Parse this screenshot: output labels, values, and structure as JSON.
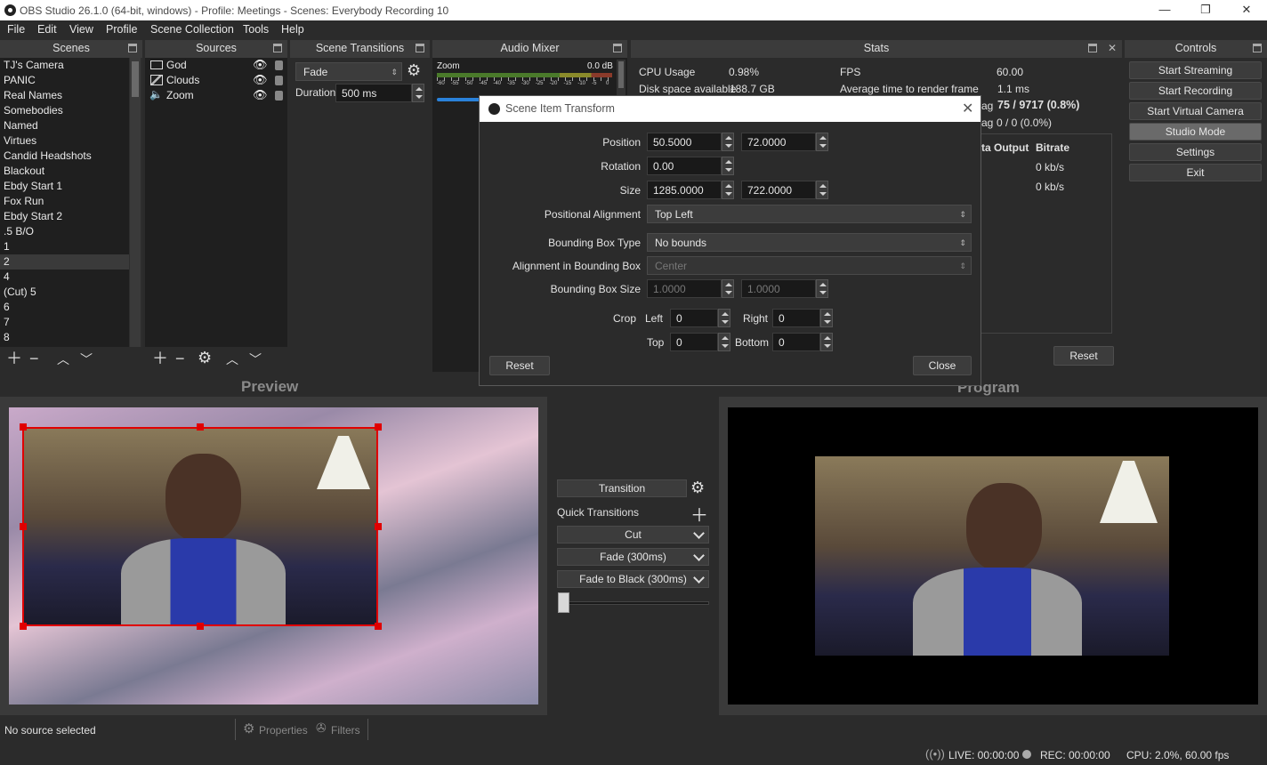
{
  "window": {
    "title": "OBS Studio 26.1.0 (64-bit, windows) - Profile: Meetings - Scenes: Everybody Recording  10",
    "minimize": "—",
    "restore": "❐",
    "close": "✕"
  },
  "menu": [
    "File",
    "Edit",
    "View",
    "Profile",
    "Scene Collection",
    "Tools",
    "Help"
  ],
  "docks": {
    "scenes": "Scenes",
    "sources": "Sources",
    "transitions": "Scene Transitions",
    "mixer": "Audio Mixer",
    "stats": "Stats",
    "controls": "Controls"
  },
  "scenes": [
    "TJ's Camera",
    "PANIC",
    "Real Names",
    "Somebodies",
    "Named",
    "Virtues",
    "Candid Headshots",
    "Blackout",
    "Ebdy Start 1",
    "Fox Run",
    "Ebdy Start 2",
    ".5 B/O",
    "1",
    "2",
    "4",
    "(Cut) 5",
    "6",
    "7",
    "8"
  ],
  "selected_scene": "2",
  "sources": [
    {
      "name": "God",
      "icon": "monitor-icon"
    },
    {
      "name": "Clouds",
      "icon": "image-icon"
    },
    {
      "name": "Zoom",
      "icon": "speaker-icon"
    }
  ],
  "transitions": {
    "current": "Fade",
    "duration_label": "Duration",
    "duration_value": "500 ms"
  },
  "mixer": {
    "source": "Zoom",
    "level": "0.0 dB",
    "ticks": [
      "-60",
      "-55",
      "-50",
      "-45",
      "-40",
      "-35",
      "-30",
      "-25",
      "-20",
      "-15",
      "-10",
      "-5",
      "0"
    ]
  },
  "stats": {
    "cpu_label": "CPU Usage",
    "cpu_value": "0.98%",
    "disk_label": "Disk space available",
    "disk_value": "188.7 GB",
    "fps_label": "FPS",
    "fps_value": "60.00",
    "render_label": "Average time to render frame",
    "render_value": "1.1 ms",
    "lag1_label": "ag",
    "lag1_value": "75 / 9717 (0.8%)",
    "lag2_label": "ag",
    "lag2_value": "0 / 0 (0.0%)",
    "output_header": "ta Output",
    "bitrate_header": "Bitrate",
    "bitrate1": "0 kb/s",
    "bitrate2": "0 kb/s",
    "reset": "Reset"
  },
  "controls": [
    "Start Streaming",
    "Start Recording",
    "Start Virtual Camera",
    "Studio Mode",
    "Settings",
    "Exit"
  ],
  "active_control": "Studio Mode",
  "dialog": {
    "title": "Scene Item Transform",
    "position_label": "Position",
    "position_x": "50.5000",
    "position_y": "72.0000",
    "rotation_label": "Rotation",
    "rotation": "0.00",
    "size_label": "Size",
    "size_w": "1285.0000",
    "size_h": "722.0000",
    "alignment_label": "Positional Alignment",
    "alignment": "Top Left",
    "bbox_type_label": "Bounding Box Type",
    "bbox_type": "No bounds",
    "bbox_align_label": "Alignment in Bounding Box",
    "bbox_align": "Center",
    "bbox_size_label": "Bounding Box Size",
    "bbox_w": "1.0000",
    "bbox_h": "1.0000",
    "crop_label": "Crop",
    "crop_left_label": "Left",
    "crop_left": "0",
    "crop_right_label": "Right",
    "crop_right": "0",
    "crop_top_label": "Top",
    "crop_top": "0",
    "crop_bottom_label": "Bottom",
    "crop_bottom": "0",
    "reset": "Reset",
    "close": "Close"
  },
  "preview_label": "Preview",
  "program_label": "Program",
  "studio": {
    "transition": "Transition",
    "quick_transitions": "Quick Transitions",
    "cut": "Cut",
    "fade": "Fade (300ms)",
    "fade_black": "Fade to Black (300ms)"
  },
  "status": {
    "selection": "No source selected",
    "properties": "Properties",
    "filters": "Filters",
    "live": "LIVE: 00:00:00",
    "rec": "REC: 00:00:00",
    "cpu": "CPU: 2.0%, 60.00 fps"
  },
  "colors": {
    "selection_border": "#e00000",
    "volume_bar": "#2a82da"
  }
}
